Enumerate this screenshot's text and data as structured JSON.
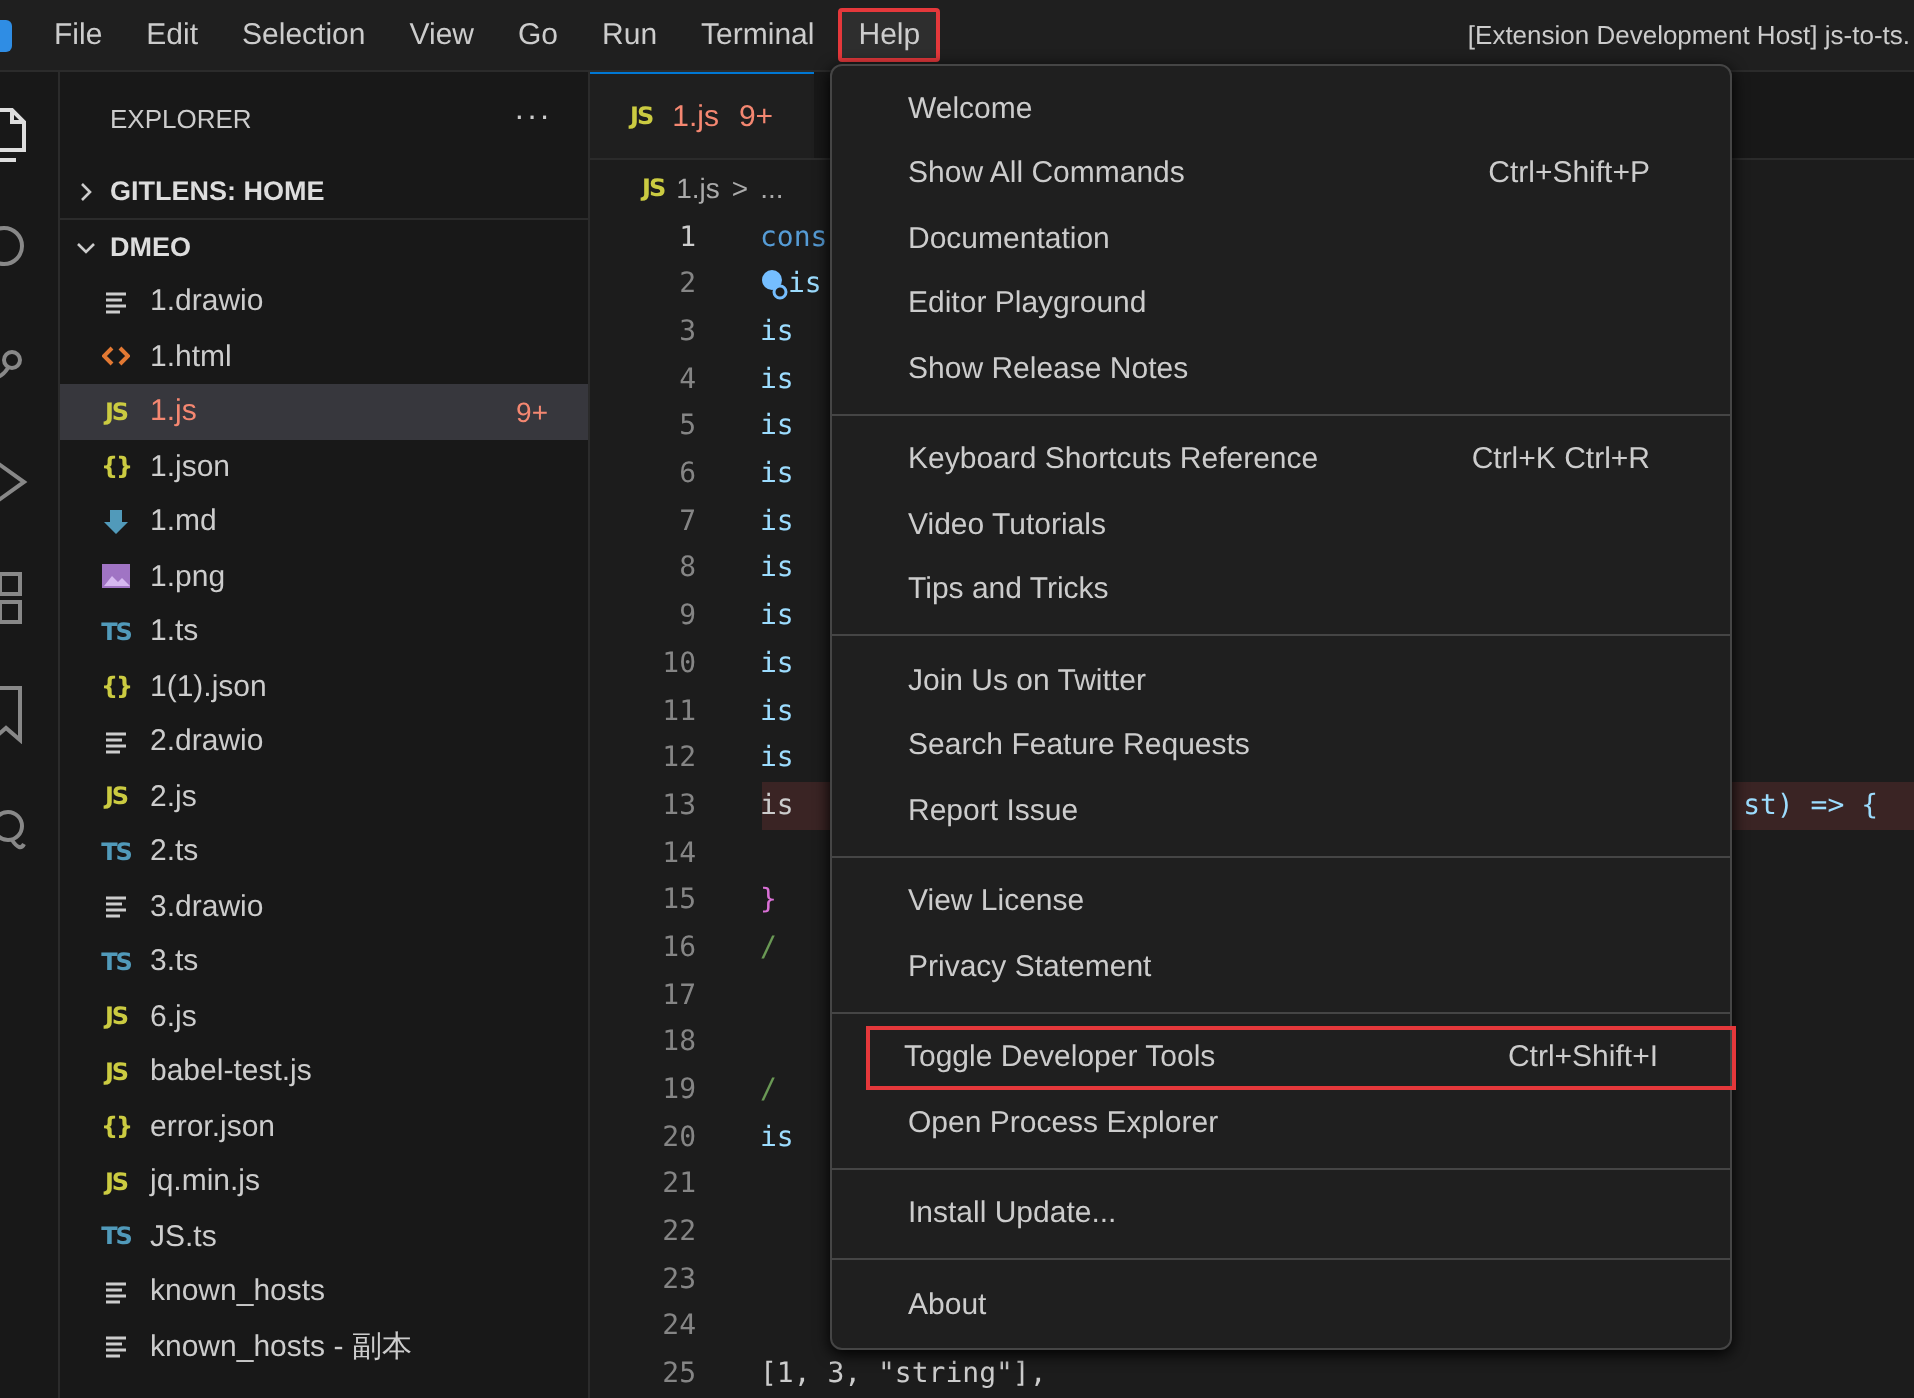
{
  "menubar": {
    "items": [
      {
        "label": "File",
        "selected": false
      },
      {
        "label": "Edit",
        "selected": false
      },
      {
        "label": "Selection",
        "selected": false
      },
      {
        "label": "View",
        "selected": false
      },
      {
        "label": "Go",
        "selected": false
      },
      {
        "label": "Run",
        "selected": false
      },
      {
        "label": "Terminal",
        "selected": false
      },
      {
        "label": "Help",
        "selected": true,
        "annotated": true
      }
    ],
    "title": "[Extension Development Host] js-to-ts."
  },
  "explorer": {
    "title": "EXPLORER",
    "more": "···",
    "sections": [
      {
        "label": "GITLENS: HOME",
        "expanded": false
      },
      {
        "label": "DMEO",
        "expanded": true
      }
    ],
    "files": [
      {
        "name": "1.drawio",
        "kind": "lines",
        "selected": false
      },
      {
        "name": "1.html",
        "kind": "html",
        "selected": false
      },
      {
        "name": "1.js",
        "kind": "js",
        "glyph": "JS",
        "selected": true,
        "error": true,
        "badge": "9+"
      },
      {
        "name": "1.json",
        "kind": "json",
        "glyph": "{}",
        "selected": false
      },
      {
        "name": "1.md",
        "kind": "md",
        "selected": false
      },
      {
        "name": "1.png",
        "kind": "png",
        "selected": false
      },
      {
        "name": "1.ts",
        "kind": "ts",
        "glyph": "TS",
        "selected": false
      },
      {
        "name": "1(1).json",
        "kind": "json",
        "glyph": "{}",
        "selected": false
      },
      {
        "name": "2.drawio",
        "kind": "lines",
        "selected": false
      },
      {
        "name": "2.js",
        "kind": "js",
        "glyph": "JS",
        "selected": false
      },
      {
        "name": "2.ts",
        "kind": "ts",
        "glyph": "TS",
        "selected": false
      },
      {
        "name": "3.drawio",
        "kind": "lines",
        "selected": false
      },
      {
        "name": "3.ts",
        "kind": "ts",
        "glyph": "TS",
        "selected": false
      },
      {
        "name": "6.js",
        "kind": "js",
        "glyph": "JS",
        "selected": false
      },
      {
        "name": "babel-test.js",
        "kind": "js",
        "glyph": "JS",
        "selected": false
      },
      {
        "name": "error.json",
        "kind": "json",
        "glyph": "{}",
        "selected": false
      },
      {
        "name": "jq.min.js",
        "kind": "js",
        "glyph": "JS",
        "selected": false
      },
      {
        "name": "JS.ts",
        "kind": "ts",
        "glyph": "TS",
        "selected": false
      },
      {
        "name": "known_hosts",
        "kind": "lines",
        "selected": false
      },
      {
        "name": "known_hosts - 副本",
        "kind": "lines",
        "selected": false
      }
    ]
  },
  "editor": {
    "tab": {
      "glyph": "JS",
      "label": "1.js",
      "badge": "9+",
      "selected": true
    },
    "breadcrumb": {
      "glyph": "JS",
      "file": "1.js",
      "sep": ">",
      "rest": "..."
    },
    "lines": [
      {
        "number": "1",
        "text": "cons",
        "kind": "keyword",
        "current": true
      },
      {
        "number": "2",
        "text": "is",
        "kind": "ident",
        "lightbulb": true
      },
      {
        "number": "3",
        "text": "is",
        "kind": "ident"
      },
      {
        "number": "4",
        "text": "is",
        "kind": "ident"
      },
      {
        "number": "5",
        "text": "is",
        "kind": "ident"
      },
      {
        "number": "6",
        "text": "is",
        "kind": "ident"
      },
      {
        "number": "7",
        "text": "is",
        "kind": "ident"
      },
      {
        "number": "8",
        "text": "is",
        "kind": "ident"
      },
      {
        "number": "9",
        "text": "is",
        "kind": "ident"
      },
      {
        "number": "10",
        "text": "is",
        "kind": "ident"
      },
      {
        "number": "11",
        "text": "is",
        "kind": "ident"
      },
      {
        "number": "12",
        "text": "is",
        "kind": "ident"
      },
      {
        "number": "13",
        "text": "is",
        "kind": "plain",
        "error": true,
        "tail": "st) => {"
      },
      {
        "number": "14"
      },
      {
        "number": "15",
        "text": "}",
        "kind": "bracket"
      },
      {
        "number": "16",
        "text": "/",
        "kind": "comment"
      },
      {
        "number": "17"
      },
      {
        "number": "18"
      },
      {
        "number": "19",
        "text": "/",
        "kind": "comment"
      },
      {
        "number": "20",
        "text": "is",
        "kind": "ident"
      },
      {
        "number": "21"
      },
      {
        "number": "22"
      },
      {
        "number": "23"
      },
      {
        "number": "24"
      },
      {
        "number": "25",
        "text": "[1, 3, \"string\"],",
        "kind": "plain"
      }
    ]
  },
  "help_menu": {
    "groups": [
      [
        {
          "label": "Welcome"
        },
        {
          "label": "Show All Commands",
          "shortcut": "Ctrl+Shift+P"
        },
        {
          "label": "Documentation"
        },
        {
          "label": "Editor Playground"
        },
        {
          "label": "Show Release Notes"
        }
      ],
      [
        {
          "label": "Keyboard Shortcuts Reference",
          "shortcut": "Ctrl+K Ctrl+R"
        },
        {
          "label": "Video Tutorials"
        },
        {
          "label": "Tips and Tricks"
        }
      ],
      [
        {
          "label": "Join Us on Twitter"
        },
        {
          "label": "Search Feature Requests"
        },
        {
          "label": "Report Issue"
        }
      ],
      [
        {
          "label": "View License"
        },
        {
          "label": "Privacy Statement"
        }
      ],
      [
        {
          "label": "Toggle Developer Tools",
          "shortcut": "Ctrl+Shift+I",
          "annotated": true
        },
        {
          "label": "Open Process Explorer"
        }
      ],
      [
        {
          "label": "Install Update..."
        }
      ],
      [
        {
          "label": "About"
        }
      ]
    ]
  }
}
